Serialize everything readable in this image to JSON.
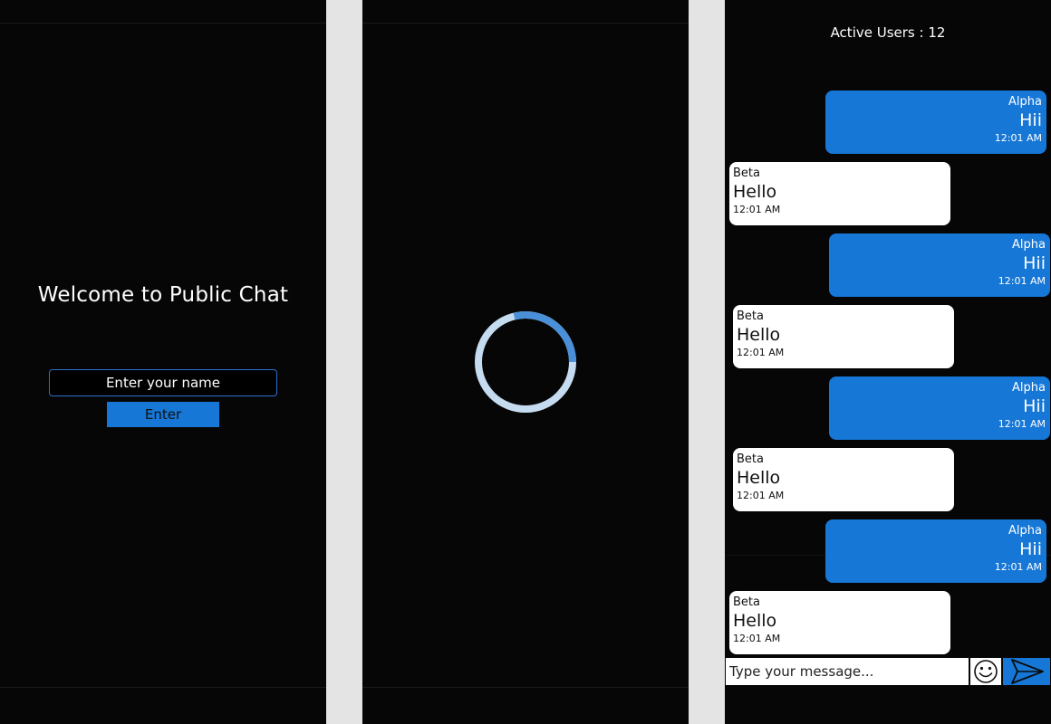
{
  "login": {
    "welcome_title": "Welcome to Public Chat",
    "name_placeholder": "Enter your name",
    "enter_label": "Enter"
  },
  "loading": {
    "icon": "loading-spinner"
  },
  "chat": {
    "active_users_label": "Active Users : 12",
    "messages": [
      {
        "sender": "Alpha",
        "text": "Hii",
        "time": "12:01 AM",
        "own": true
      },
      {
        "sender": "Beta",
        "text": "Hello",
        "time": "12:01 AM",
        "own": false
      },
      {
        "sender": "Alpha",
        "text": "Hii",
        "time": "12:01 AM",
        "own": true
      },
      {
        "sender": "Beta",
        "text": "Hello",
        "time": "12:01 AM",
        "own": false
      },
      {
        "sender": "Alpha",
        "text": "Hii",
        "time": "12:01 AM",
        "own": true
      },
      {
        "sender": "Beta",
        "text": "Hello",
        "time": "12:01 AM",
        "own": false
      },
      {
        "sender": "Alpha",
        "text": "Hii",
        "time": "12:01 AM",
        "own": true
      },
      {
        "sender": "Beta",
        "text": "Hello",
        "time": "12:01 AM",
        "own": false
      }
    ],
    "message_placeholder": "Type your message...",
    "emoji_icon": "smiley-icon",
    "send_icon": "send-icon"
  },
  "colors": {
    "background": "#060606",
    "accent": "#1677d6",
    "spinner_track": "#c5dbf0",
    "spinner_arc": "#4a90d8"
  }
}
